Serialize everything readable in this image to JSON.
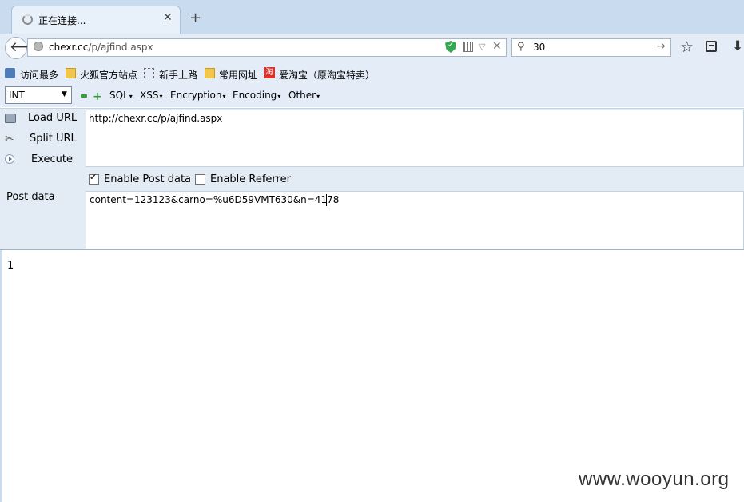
{
  "tab": {
    "title": "正在连接...",
    "close_glyph": "✕",
    "newtab_glyph": "+"
  },
  "navbar": {
    "url_host": "chexr.cc",
    "url_path": "/p/ajfind.aspx",
    "search_value": "30"
  },
  "bookmarks": [
    {
      "label": "访问最多",
      "icon": "bookmark-page-icon"
    },
    {
      "label": "火狐官方站点",
      "icon": "folder-icon"
    },
    {
      "label": "新手上路",
      "icon": "dashed-box-icon"
    },
    {
      "label": "常用网址",
      "icon": "folder-icon"
    },
    {
      "label": "爱淘宝（原淘宝特卖）",
      "icon": "taobao-icon",
      "icon_text": "淘"
    }
  ],
  "hackbar": {
    "select_value": "INT",
    "menus": [
      "SQL",
      "XSS",
      "Encryption",
      "Encoding",
      "Other"
    ],
    "load_url_label": "Load URL",
    "split_url_label": "Split URL",
    "execute_label": "Execute",
    "url_value": "http://chexr.cc/p/ajfind.aspx",
    "enable_post_label": "Enable Post data",
    "enable_post_checked": true,
    "enable_referrer_label": "Enable Referrer",
    "enable_referrer_checked": false,
    "post_data_label": "Post data",
    "post_data_value": "content=123123&carno=%u6D59VMT630&n=4178"
  },
  "page": {
    "result": "1"
  },
  "watermark": "www.wooyun.org"
}
